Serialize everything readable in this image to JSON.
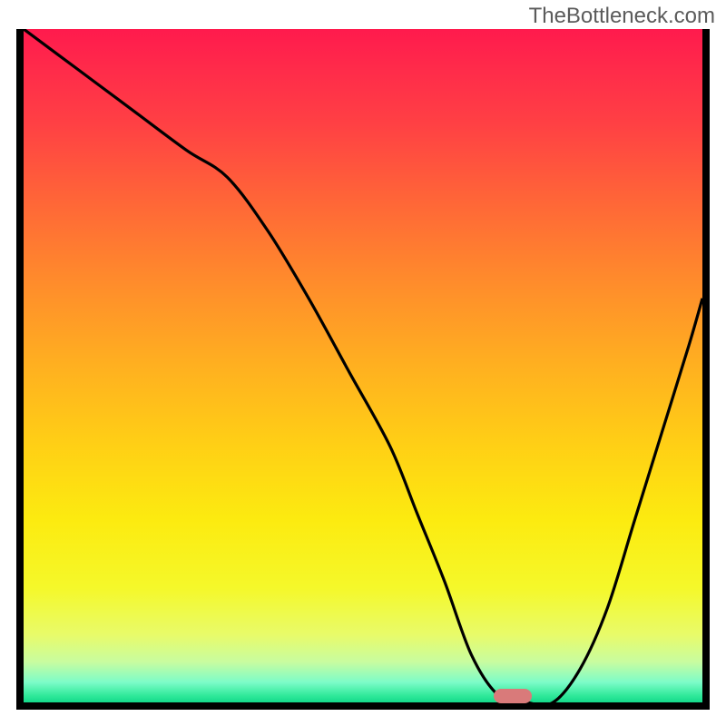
{
  "watermark": "TheBottleneck.com",
  "chart_data": {
    "type": "line",
    "title": "",
    "xlabel": "",
    "ylabel": "",
    "xlim": [
      0,
      100
    ],
    "ylim": [
      0,
      100
    ],
    "series": [
      {
        "name": "curve",
        "x": [
          0,
          8,
          16,
          24,
          30,
          36,
          42,
          48,
          54,
          58,
          62,
          66,
          70,
          74,
          78,
          82,
          86,
          90,
          94,
          98,
          100
        ],
        "values": [
          100,
          94,
          88,
          82,
          78,
          70,
          60,
          49,
          38,
          28,
          18,
          7,
          1,
          0,
          0,
          5,
          14,
          27,
          40,
          53,
          60
        ]
      }
    ],
    "annotations": [
      {
        "type": "marker",
        "x": 72,
        "y": 1,
        "color": "#d97a7a",
        "shape": "pill"
      }
    ],
    "background_gradient_stops": [
      {
        "pos": 0,
        "color": "#ff1a4d"
      },
      {
        "pos": 50,
        "color": "#ffb020"
      },
      {
        "pos": 80,
        "color": "#f5f82a"
      },
      {
        "pos": 100,
        "color": "#14d98a"
      }
    ]
  }
}
